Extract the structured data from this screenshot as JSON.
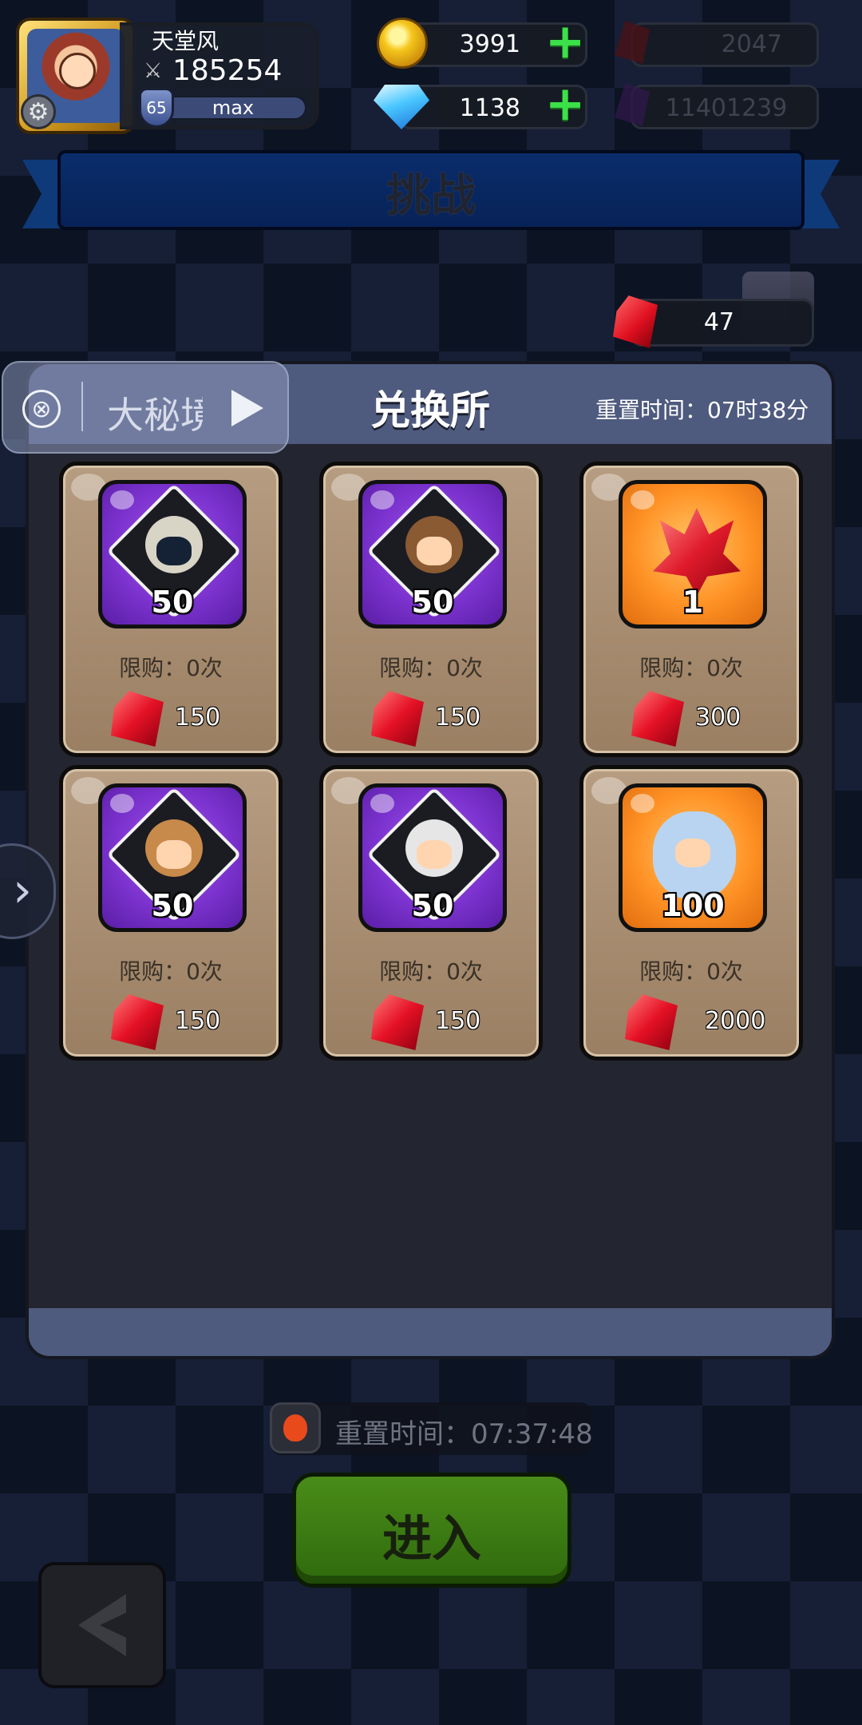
{
  "player": {
    "name": "天堂风",
    "power": "185254",
    "level": "65",
    "level_bar_label": "max"
  },
  "resources": {
    "gold": "3991",
    "diamonds": "1138",
    "red_crystal": "2047",
    "purple_crystal": "11401239"
  },
  "screen_title": "挑战",
  "ruby_counter": "47",
  "float_widget": {
    "close_glyph": "⊗",
    "label": "大秘境"
  },
  "shop": {
    "title": "兑换所",
    "reset_time": "重置时间：07时38分",
    "items": [
      {
        "type": "hero",
        "qty": "50",
        "limit": "限购：0次",
        "price": "150",
        "color": "#7c33cf"
      },
      {
        "type": "hero",
        "qty": "50",
        "limit": "限购：0次",
        "price": "150",
        "color": "#7c33cf"
      },
      {
        "type": "red-crystal",
        "qty": "1",
        "limit": "限购：0次",
        "price": "300",
        "color": "#ff9226"
      },
      {
        "type": "hero",
        "qty": "50",
        "limit": "限购：0次",
        "price": "150",
        "color": "#7c33cf"
      },
      {
        "type": "hero",
        "qty": "50",
        "limit": "限购：0次",
        "price": "150",
        "color": "#7c33cf"
      },
      {
        "type": "hero",
        "qty": "100",
        "limit": "限购：0次",
        "price": "2000",
        "color": "#ff9226"
      }
    ]
  },
  "bottom": {
    "reset_countdown": "重置时间：07:37:48",
    "enter_label": "进入"
  },
  "icons": {
    "gear": "gear-icon",
    "plus": "plus-icon",
    "back": "back-arrow-icon",
    "side": "chevron-right-icon"
  }
}
